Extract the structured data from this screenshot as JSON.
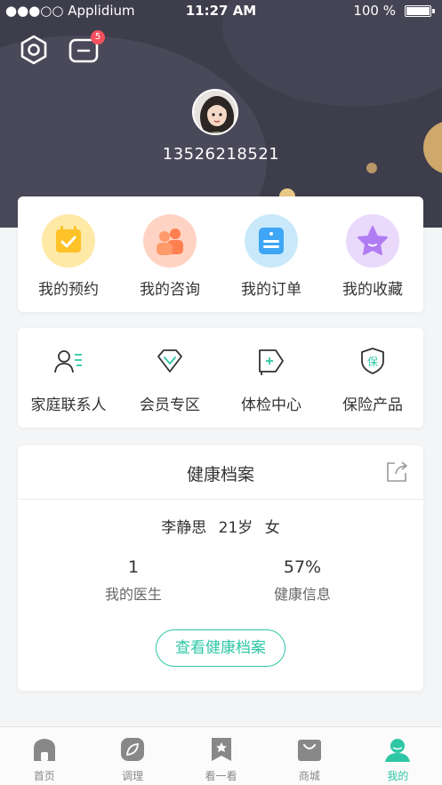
{
  "status_bar": {
    "carrier": "●●●○○ Applidium",
    "time": "11:27 AM",
    "battery": "100 %"
  },
  "header": {
    "message_badge": "5",
    "phone": "13526218521"
  },
  "quick_actions": [
    {
      "label": "我的预约",
      "icon": "calendar-check-icon",
      "color": "#ffd050"
    },
    {
      "label": "我的咨询",
      "icon": "consult-people-icon",
      "color": "#ff8a5b"
    },
    {
      "label": "我的订单",
      "icon": "order-list-icon",
      "color": "#41a8f5"
    },
    {
      "label": "我的收藏",
      "icon": "star-icon",
      "color": "#b57cf0"
    }
  ],
  "services": [
    {
      "label": "家庭联系人",
      "icon": "family-contact-icon"
    },
    {
      "label": "会员专区",
      "icon": "diamond-icon"
    },
    {
      "label": "体检中心",
      "icon": "checkup-tag-icon"
    },
    {
      "label": "保险产品",
      "icon": "insurance-shield-icon",
      "glyph": "保"
    }
  ],
  "health_archive": {
    "title": "健康档案",
    "name": "李静思",
    "age": "21岁",
    "gender": "女",
    "doctor_count": "1",
    "doctor_label": "我的医生",
    "health_percent": "57%",
    "health_label": "健康信息",
    "view_button": "查看健康档案"
  },
  "tabbar": [
    {
      "label": "首页",
      "icon": "home-icon",
      "active": false
    },
    {
      "label": "调理",
      "icon": "leaf-icon",
      "active": false
    },
    {
      "label": "看一看",
      "icon": "bookmark-star-icon",
      "active": false
    },
    {
      "label": "商城",
      "icon": "shop-bag-icon",
      "active": false
    },
    {
      "label": "我的",
      "icon": "profile-icon",
      "active": true
    }
  ],
  "colors": {
    "accent": "#2ec7a6",
    "header_bg": "#3e3d4c",
    "badge": "#f4515e"
  }
}
